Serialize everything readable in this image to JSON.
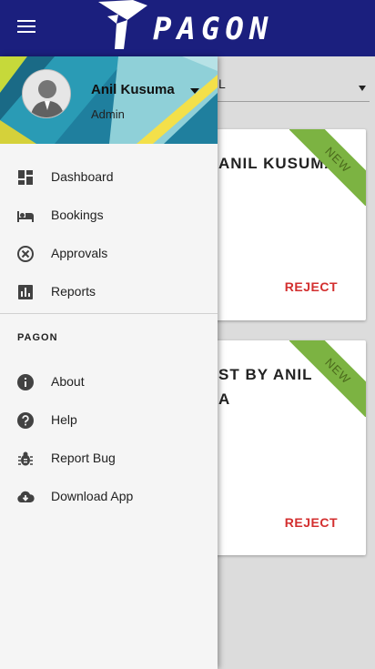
{
  "appbar": {
    "menu_icon": "hamburger-menu-icon",
    "brand_text": "PAGON",
    "bg_color": "#1b1f7e"
  },
  "background": {
    "select_value": "L",
    "cards": [
      {
        "title": "ANIL KUSUMA",
        "badge": "NEW",
        "action": "REJECT"
      },
      {
        "title": "ST BY ANIL A",
        "badge": "NEW",
        "action": "REJECT"
      }
    ],
    "badge_color": "#7cb342",
    "reject_color": "#d32f2f"
  },
  "drawer": {
    "user": {
      "name": "Anil Kusuma",
      "role": "Admin"
    },
    "primary_items": [
      {
        "label": "Dashboard",
        "icon": "dashboard-icon"
      },
      {
        "label": "Bookings",
        "icon": "bed-icon"
      },
      {
        "label": "Approvals",
        "icon": "cancel-circle-icon"
      },
      {
        "label": "Reports",
        "icon": "bar-chart-icon"
      }
    ],
    "section_title": "PAGON",
    "secondary_items": [
      {
        "label": "About",
        "icon": "info-icon"
      },
      {
        "label": "Help",
        "icon": "help-icon"
      },
      {
        "label": "Report Bug",
        "icon": "bug-icon"
      },
      {
        "label": "Download App",
        "icon": "cloud-download-icon"
      }
    ]
  }
}
